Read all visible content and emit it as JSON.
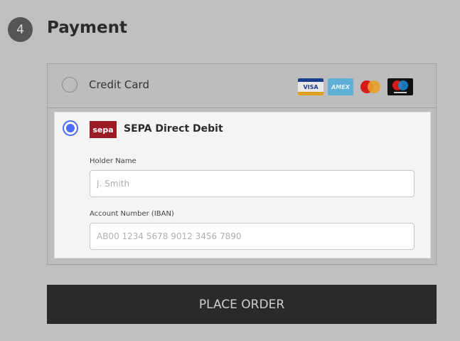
{
  "step": {
    "number": "4",
    "title": "Payment"
  },
  "methods": {
    "credit_card": {
      "label": "Credit Card",
      "cards": [
        "VISA",
        "AMEX",
        "mastercard",
        "maestro"
      ]
    },
    "sepa": {
      "label": "SEPA Direct Debit",
      "logo": "sepa",
      "holder_label": "Holder Name",
      "holder_placeholder": "J. Smith",
      "iban_label": "Account Number (IBAN)",
      "iban_placeholder": "AB00 1234 5678 9012 3456 7890"
    }
  },
  "place_order": "PLACE ORDER"
}
